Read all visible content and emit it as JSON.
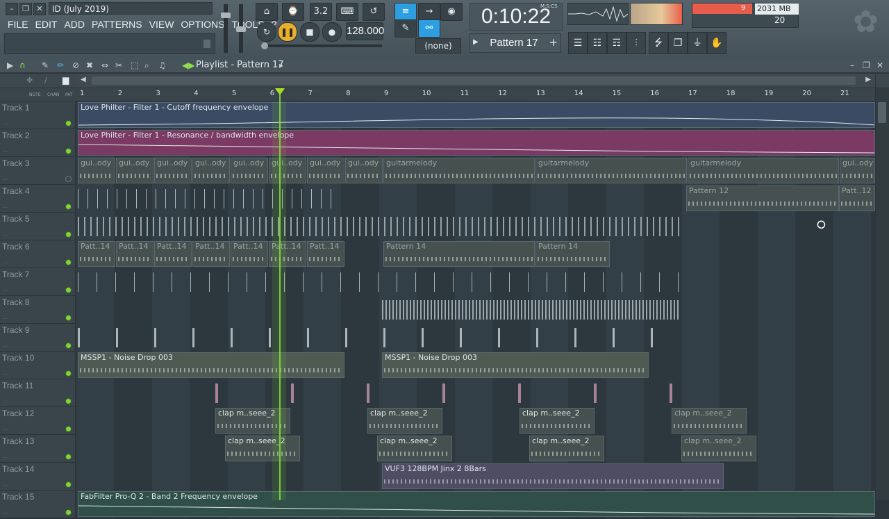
{
  "window": {
    "title": "ID (July 2019)",
    "buttons": [
      "–",
      "❐",
      "✕"
    ]
  },
  "menu": [
    "FILE",
    "EDIT",
    "ADD",
    "PATTERNS",
    "VIEW",
    "OPTIONS",
    "TOOLS",
    "?"
  ],
  "transport": {
    "tempo": "128.000",
    "time": "0:10:22",
    "time_label": "M:S:CS",
    "pattern": "Pattern 17",
    "snap": "(none)",
    "step_label": "3.2"
  },
  "monitor": {
    "cpu": "9",
    "memory": "2031 MB",
    "polyphony": "20"
  },
  "playlist": {
    "title": "Playlist - Pattern 17",
    "col_headers": [
      "NOTE",
      "CHAN",
      "PAT"
    ],
    "bars": [
      "1",
      "2",
      "3",
      "4",
      "5",
      "6",
      "7",
      "8",
      "9",
      "10",
      "11",
      "12",
      "13",
      "14",
      "15",
      "16",
      "17",
      "18",
      "19",
      "20",
      "21"
    ]
  },
  "tracks": [
    {
      "name": "Track 1",
      "clips": [
        {
          "label": "Love Philter - Filter 1 - Cutoff frequency envelope"
        }
      ]
    },
    {
      "name": "Track 2",
      "clips": [
        {
          "label": "Love Philter - Filter 1 - Resonance / bandwidth envelope"
        }
      ]
    },
    {
      "name": "Track 3",
      "clips": [
        {
          "label": "gui..ody"
        },
        {
          "label": "gui..ody"
        },
        {
          "label": "gui..ody"
        },
        {
          "label": "gui..ody"
        },
        {
          "label": "gui..ody"
        },
        {
          "label": "gui..ody"
        },
        {
          "label": "gui..ody"
        },
        {
          "label": "gui..ody"
        },
        {
          "label": "guitarmelody"
        },
        {
          "label": "guitarmelody"
        },
        {
          "label": "guitarmelody"
        },
        {
          "label": "gui..ody"
        }
      ]
    },
    {
      "name": "Track 4",
      "clips": [
        {
          "label": "Pattern 12"
        },
        {
          "label": "Patt..12"
        }
      ]
    },
    {
      "name": "Track 5",
      "clips": []
    },
    {
      "name": "Track 6",
      "clips": [
        {
          "label": "Patt..14"
        },
        {
          "label": "Patt..14"
        },
        {
          "label": "Patt..14"
        },
        {
          "label": "Patt..14"
        },
        {
          "label": "Patt..14"
        },
        {
          "label": "Patt..14"
        },
        {
          "label": "Patt..14"
        },
        {
          "label": "Pattern 14"
        },
        {
          "label": "Pattern 14"
        }
      ]
    },
    {
      "name": "Track 7",
      "clips": []
    },
    {
      "name": "Track 8",
      "clips": []
    },
    {
      "name": "Track 9",
      "clips": []
    },
    {
      "name": "Track 10",
      "clips": [
        {
          "label": "MSSP1 - Noise Drop 003"
        },
        {
          "label": "MSSP1 - Noise Drop 003"
        }
      ]
    },
    {
      "name": "Track 11",
      "clips": []
    },
    {
      "name": "Track 12",
      "clips": [
        {
          "label": "clap m..seee_2"
        },
        {
          "label": "clap m..seee_2"
        },
        {
          "label": "clap m..seee_2"
        },
        {
          "label": "clap m..seee_2"
        }
      ]
    },
    {
      "name": "Track 13",
      "clips": [
        {
          "label": "clap m..seee_2"
        },
        {
          "label": "clap m..seee_2"
        },
        {
          "label": "clap m..seee_2"
        },
        {
          "label": "clap m..seee_2"
        }
      ]
    },
    {
      "name": "Track 14",
      "clips": [
        {
          "label": "VUF3 128BPM Jinx 2 8Bars"
        }
      ]
    },
    {
      "name": "Track 15",
      "clips": [
        {
          "label": "FabFilter Pro-Q 2 - Band 2 Frequency envelope"
        }
      ]
    }
  ]
}
